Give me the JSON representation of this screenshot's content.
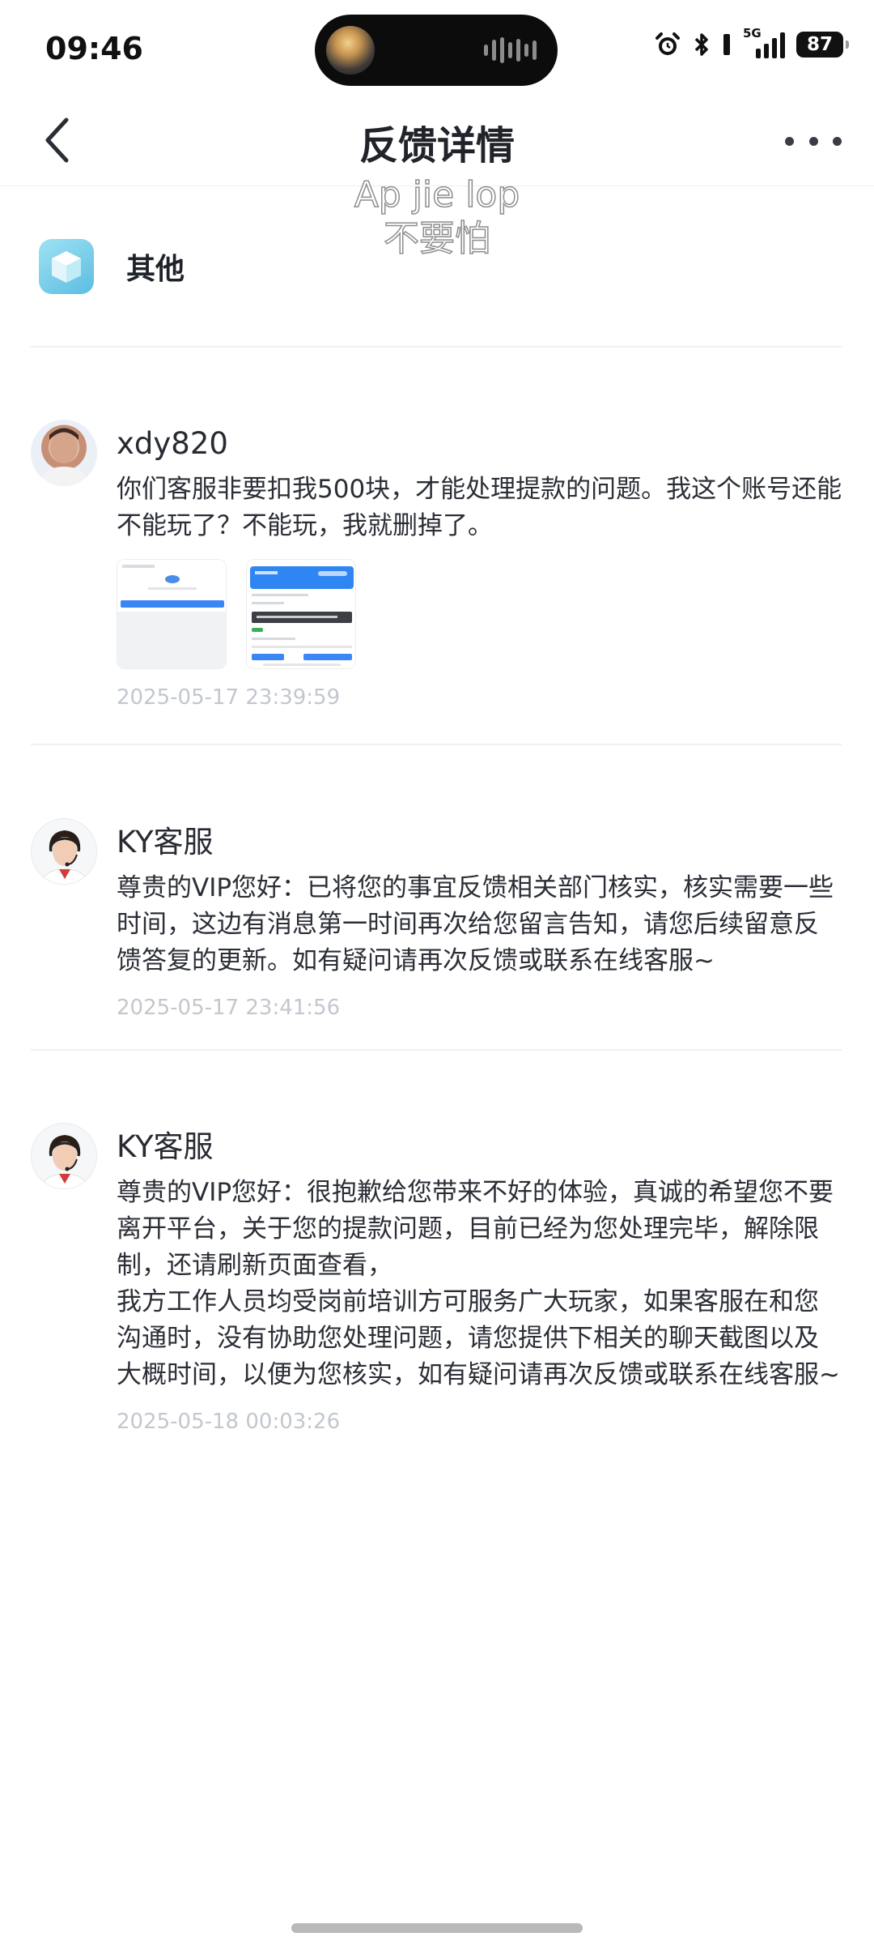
{
  "status_bar": {
    "time": "09:46",
    "network": "5G",
    "battery": "87"
  },
  "header": {
    "title": "反馈详情"
  },
  "watermark": {
    "line1": "Ap jie lop",
    "line2": "不要怕"
  },
  "category": {
    "label": "其他"
  },
  "messages": [
    {
      "sender": "xdy820",
      "text": "你们客服非要扣我500块，才能处理提款的问题。我这个账号还能不能玩了？不能玩，我就删掉了。",
      "time": "2025-05-17 23:39:59",
      "attachments": [
        "screenshot-1",
        "screenshot-2"
      ]
    },
    {
      "sender": "KY客服",
      "text": "尊贵的VIP您好：已将您的事宜反馈相关部门核实，核实需要一些时间，这边有消息第一时间再次给您留言告知，请您后续留意反馈答复的更新。如有疑问请再次反馈或联系在线客服~",
      "time": "2025-05-17 23:41:56"
    },
    {
      "sender": "KY客服",
      "text": "尊贵的VIP您好：很抱歉给您带来不好的体验，真诚的希望您不要离开平台，关于您的提款问题，目前已经为您处理完毕，解除限制，还请刷新页面查看，\n我方工作人员均受岗前培训方可服务广大玩家，如果客服在和您沟通时，没有协助您处理问题，请您提供下相关的聊天截图以及大概时间，以便为您核实，如有疑问请再次反馈或联系在线客服~",
      "time": "2025-05-18 00:03:26"
    }
  ]
}
